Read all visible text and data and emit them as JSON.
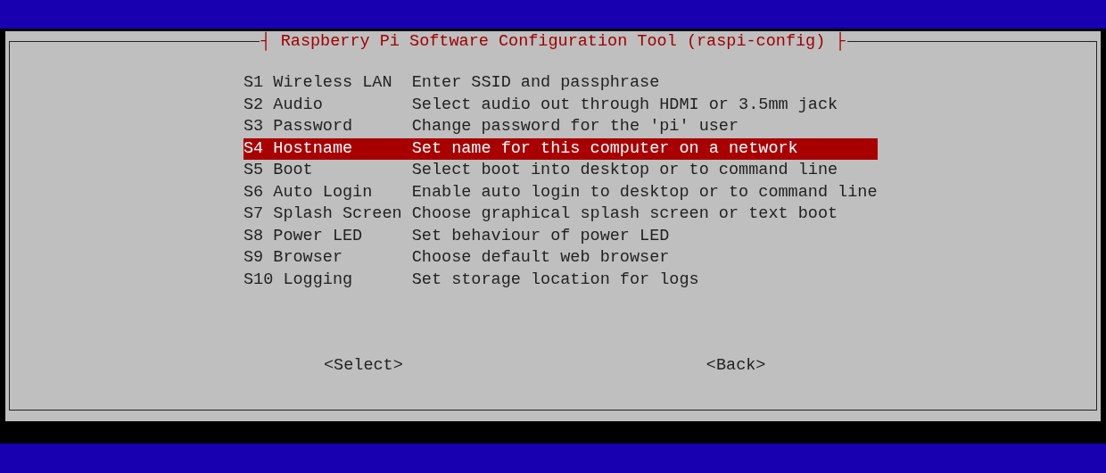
{
  "dialog": {
    "title": "┤ Raspberry Pi Software Configuration Tool (raspi-config) ├",
    "menu": [
      {
        "label": "S1 Wireless LAN",
        "description": "Enter SSID and passphrase",
        "selected": false
      },
      {
        "label": "S2 Audio",
        "description": "Select audio out through HDMI or 3.5mm jack",
        "selected": false
      },
      {
        "label": "S3 Password",
        "description": "Change password for the 'pi' user",
        "selected": false
      },
      {
        "label": "S4 Hostname",
        "description": "Set name for this computer on a network",
        "selected": true
      },
      {
        "label": "S5 Boot",
        "description": "Select boot into desktop or to command line",
        "selected": false
      },
      {
        "label": "S6 Auto Login",
        "description": "Enable auto login to desktop or to command line",
        "selected": false
      },
      {
        "label": "S7 Splash Screen",
        "description": "Choose graphical splash screen or text boot",
        "selected": false
      },
      {
        "label": "S8 Power LED",
        "description": "Set behaviour of power LED",
        "selected": false
      },
      {
        "label": "S9 Browser",
        "description": "Choose default web browser",
        "selected": false
      },
      {
        "label": "S10 Logging",
        "description": "Set storage location for logs",
        "selected": false
      }
    ],
    "buttons": [
      {
        "label": "<Select>",
        "selected": false
      },
      {
        "label": "<Back>",
        "selected": false
      }
    ]
  }
}
